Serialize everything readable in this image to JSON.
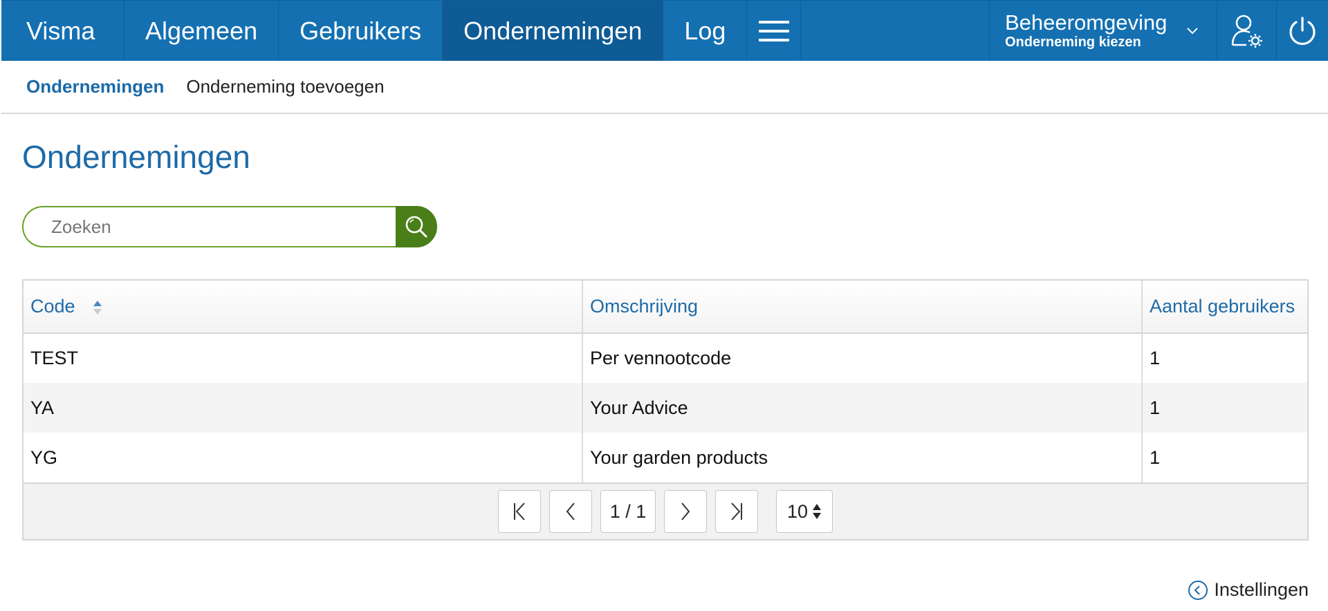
{
  "navbar": {
    "brand": "Visma",
    "items": [
      {
        "label": "Algemeen"
      },
      {
        "label": "Gebruikers"
      },
      {
        "label": "Ondernemingen"
      },
      {
        "label": "Log"
      }
    ],
    "environment": {
      "title": "Beheeromgeving",
      "subtitle": "Onderneming kiezen"
    },
    "icons": [
      "user-settings-icon",
      "power-icon",
      "hamburger-menu-icon",
      "chevron-down-icon"
    ]
  },
  "subnav": {
    "items": [
      {
        "label": "Ondernemingen",
        "active": true
      },
      {
        "label": "Onderneming toevoegen",
        "active": false
      }
    ]
  },
  "page": {
    "title": "Ondernemingen"
  },
  "search": {
    "placeholder": "Zoeken",
    "value": "",
    "icon": "search-icon"
  },
  "table": {
    "columns": [
      "Code",
      "Omschrijving",
      "Aantal gebruikers"
    ],
    "sort_column": "Code",
    "rows": [
      {
        "code": "TEST",
        "omschrijving": "Per vennootcode",
        "aantal": "1"
      },
      {
        "code": "YA",
        "omschrijving": "Your Advice",
        "aantal": "1"
      },
      {
        "code": "YG",
        "omschrijving": "Your garden products",
        "aantal": "1"
      }
    ]
  },
  "pager": {
    "page_indicator": "1 / 1",
    "page_size": "10"
  },
  "footer": {
    "settings_label": "Instellingen"
  },
  "colors": {
    "navbar": "#1470b1",
    "navbar_active": "#0e5b95",
    "accent_text": "#1e6aa7",
    "search_border": "#6aa127",
    "search_button": "#4a7e18"
  }
}
